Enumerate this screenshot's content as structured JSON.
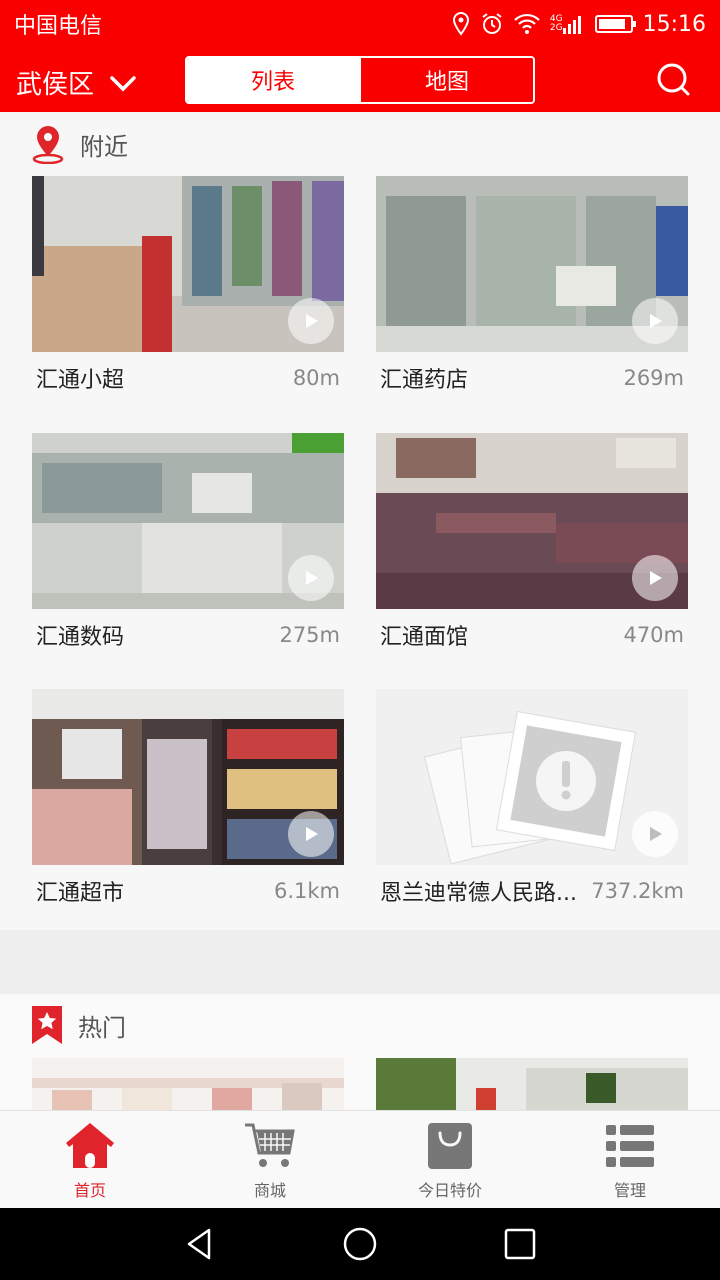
{
  "status_bar": {
    "carrier": "中国电信",
    "time": "15:16",
    "net_top": "4G",
    "net_bottom": "2G"
  },
  "header": {
    "district": "武侯区",
    "tab_list": "列表",
    "tab_map": "地图"
  },
  "nearby": {
    "title": "附近",
    "items": [
      {
        "name": "汇通小超",
        "distance": "80m"
      },
      {
        "name": "汇通药店",
        "distance": "269m"
      },
      {
        "name": "汇通数码",
        "distance": "275m"
      },
      {
        "name": "汇通面馆",
        "distance": "470m"
      },
      {
        "name": "汇通超市",
        "distance": "6.1km"
      },
      {
        "name": "恩兰迪常德人民路...",
        "distance": "737.2km"
      }
    ]
  },
  "hot": {
    "title": "热门"
  },
  "tabbar": {
    "home": "首页",
    "mall": "商城",
    "deals": "今日特价",
    "manage": "管理"
  },
  "colors": {
    "brand_red": "#fa0000",
    "tab_active": "#e0242b"
  }
}
